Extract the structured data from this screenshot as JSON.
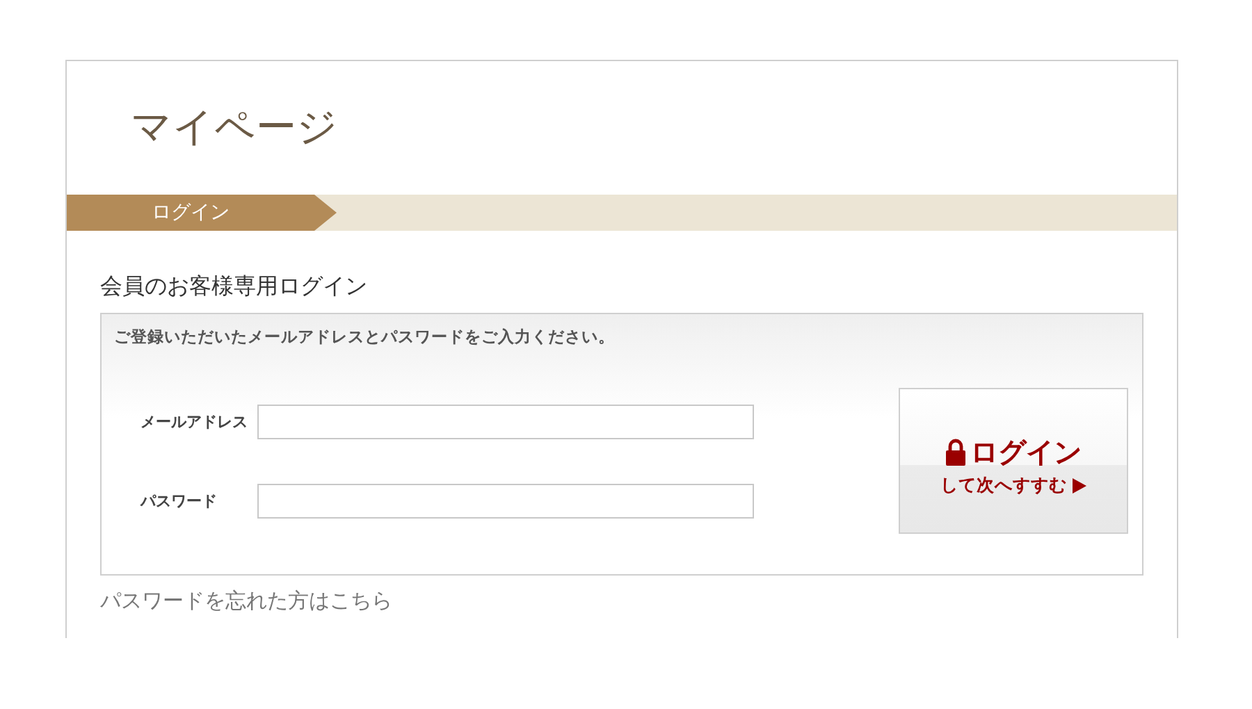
{
  "page": {
    "title": "マイページ"
  },
  "breadcrumb": {
    "label": "ログイン"
  },
  "login": {
    "heading": "会員のお客様専用ログイン",
    "instruction": "ご登録いただいたメールアドレスとパスワードをご入力ください。",
    "fields": [
      {
        "label": "メールアドレス"
      },
      {
        "label": "パスワード"
      }
    ],
    "button": {
      "label": "ログイン",
      "sublabel": "して次へすすむ"
    },
    "forgot_link": "パスワードを忘れた方はこちら"
  }
}
